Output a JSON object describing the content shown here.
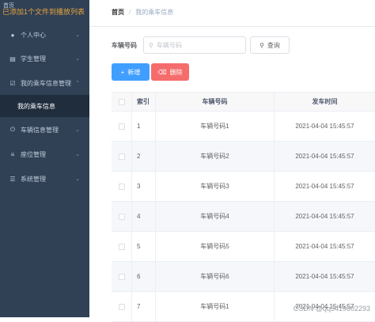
{
  "overlay": {
    "text": "已添加1个文件到播放列表"
  },
  "sidebar": {
    "home_label": "首页",
    "items": [
      {
        "label": "个人中心",
        "icon": "user-icon"
      },
      {
        "label": "学生管理",
        "icon": "list-icon"
      },
      {
        "label": "我的乘车信息管理",
        "icon": "checkbox-icon"
      },
      {
        "label": "我的乘车信息",
        "icon": "",
        "sub": true
      },
      {
        "label": "车辆信息管理",
        "icon": "power-icon"
      },
      {
        "label": "座位管理",
        "icon": "menu-icon"
      },
      {
        "label": "系统管理",
        "icon": "stack-icon"
      }
    ]
  },
  "breadcrumb": {
    "home": "首页",
    "separator": "/",
    "current": "我的乘车信息"
  },
  "search": {
    "label": "车辆号码",
    "placeholder": "车辆号码",
    "query_button": "查询"
  },
  "toolbar": {
    "add_label": "新增",
    "delete_label": "删除",
    "add_color": "#409eff",
    "delete_color": "#f56c6c"
  },
  "table": {
    "headers": {
      "index": "索引",
      "plate": "车辆号码",
      "time": "发车时间"
    },
    "rows": [
      {
        "index": "1",
        "plate": "车辆号码1",
        "time": "2021-04-04 15:45:57"
      },
      {
        "index": "2",
        "plate": "车辆号码2",
        "time": "2021-04-04 15:45:57"
      },
      {
        "index": "3",
        "plate": "车辆号码3",
        "time": "2021-04-04 15:45:57"
      },
      {
        "index": "4",
        "plate": "车辆号码4",
        "time": "2021-04-04 15:45:57"
      },
      {
        "index": "5",
        "plate": "车辆号码5",
        "time": "2021-04-04 15:45:57"
      },
      {
        "index": "6",
        "plate": "车辆号码6",
        "time": "2021-04-04 15:45:57"
      },
      {
        "index": "7",
        "plate": "车辆号码1",
        "time": "2021-04-04 15:45:57"
      }
    ]
  },
  "watermark": "CSDN @qq3419802293"
}
